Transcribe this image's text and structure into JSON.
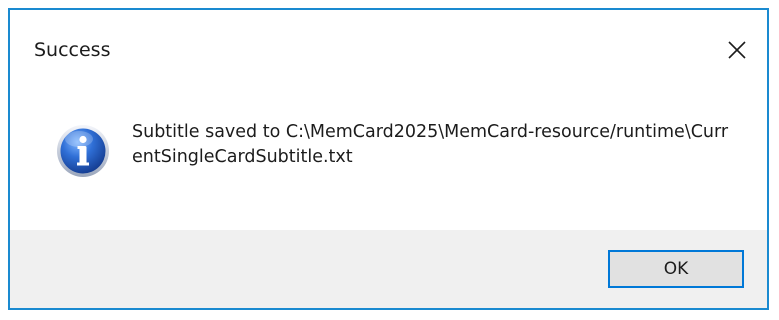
{
  "dialog": {
    "title": "Success",
    "message": "Subtitle saved to C:\\MemCard2025\\MemCard-resource/runtime\\CurrentSingleCardSubtitle.txt",
    "icon": "info-icon",
    "ok_label": "OK",
    "close_icon": "close-icon"
  },
  "colors": {
    "border": "#1a8ad0",
    "footer_bg": "#f0f0f0",
    "button_bg": "#e1e1e1",
    "button_focus_border": "#0078d7"
  }
}
